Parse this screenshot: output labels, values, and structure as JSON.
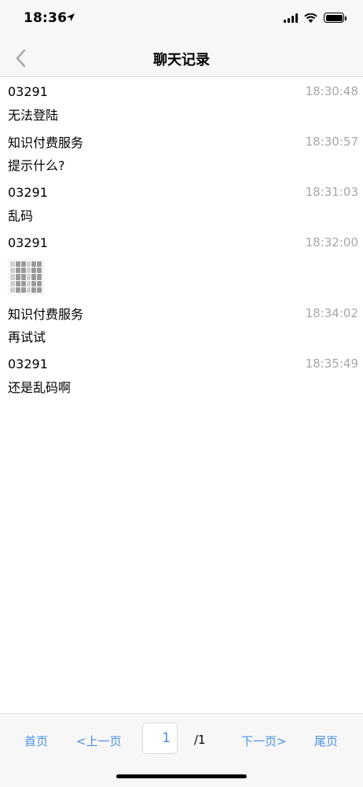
{
  "status": {
    "time": "18:36",
    "location_icon": "location-arrow-icon",
    "signal_icon": "cellular-signal-icon",
    "wifi_icon": "wifi-icon",
    "battery_icon": "battery-icon"
  },
  "nav": {
    "title": "聊天记录",
    "back_icon": "chevron-left-icon"
  },
  "messages": [
    {
      "sender": "03291",
      "time": "18:30:48",
      "text": "无法登陆"
    },
    {
      "sender": "知识付费服务",
      "time": "18:30:57",
      "text": "提示什么?"
    },
    {
      "sender": "03291",
      "time": "18:31:03",
      "text": "乱码"
    },
    {
      "sender": "03291",
      "time": "18:32:00",
      "image": "garbled-screenshot-thumbnail"
    },
    {
      "sender": "知识付费服务",
      "time": "18:34:02",
      "text": "再试试"
    },
    {
      "sender": "03291",
      "time": "18:35:49",
      "text": "还是乱码啊"
    }
  ],
  "pager": {
    "first": "首页",
    "prev": "<上一页",
    "page": "1",
    "total": "/1",
    "next": "下一页>",
    "last": "尾页"
  },
  "colors": {
    "link": "#4a90e2",
    "timestamp": "#a6a6a6",
    "bar_bg": "#f7f7f7"
  }
}
